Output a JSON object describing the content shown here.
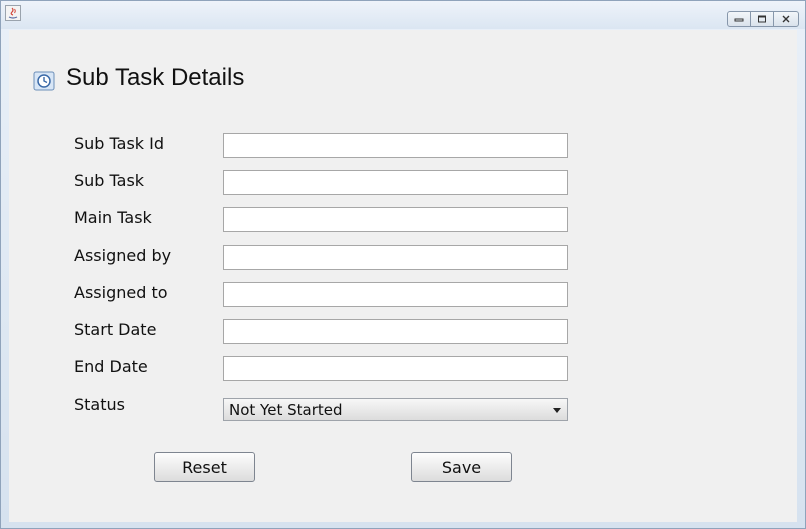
{
  "window": {
    "title": "",
    "controls": [
      "minimize-icon",
      "maximize-icon",
      "close-icon"
    ]
  },
  "form": {
    "heading": "Sub Task Details",
    "fields": [
      {
        "label": "Sub Task Id",
        "value": ""
      },
      {
        "label": "Sub Task",
        "value": ""
      },
      {
        "label": "Main Task",
        "value": ""
      },
      {
        "label": "Assigned by",
        "value": ""
      },
      {
        "label": "Assigned to",
        "value": ""
      },
      {
        "label": "Start Date",
        "value": ""
      },
      {
        "label": "End Date",
        "value": ""
      }
    ],
    "status": {
      "label": "Status",
      "selected": "Not Yet Started"
    }
  },
  "buttons": {
    "reset": "Reset",
    "save": "Save"
  }
}
